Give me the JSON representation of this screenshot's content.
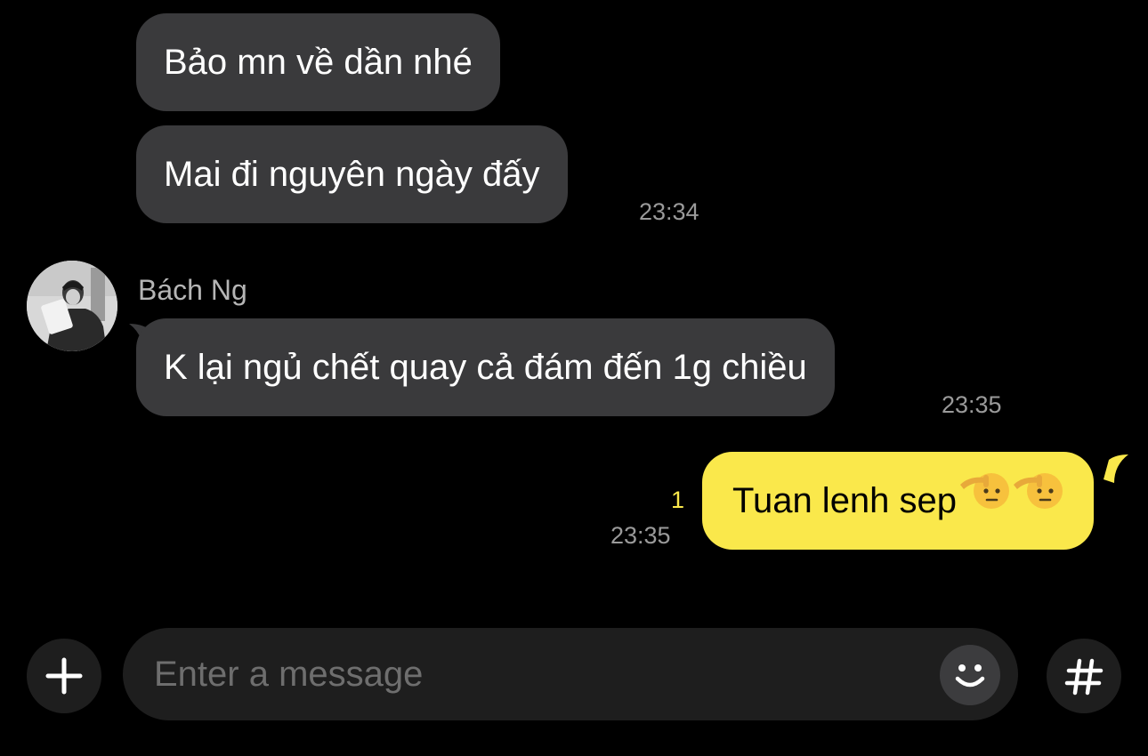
{
  "messages": [
    {
      "text": "Bảo mn về dần nhé"
    },
    {
      "text": "Mai đi nguyên ngày đấy",
      "time": "23:34"
    },
    {
      "sender": "Bách Ng",
      "text": "K lại ngủ chết quay cả đám đến 1g chiều",
      "time": "23:35"
    },
    {
      "text": "Tuan lenh sep",
      "emoji": [
        "saluting-face",
        "saluting-face"
      ],
      "unread_count": "1",
      "time": "23:35"
    }
  ],
  "composer": {
    "placeholder": "Enter a message",
    "add_icon": "plus-icon",
    "emoji_icon": "smiley-icon",
    "hashtag_icon": "hashtag-icon"
  },
  "colors": {
    "background": "#000000",
    "incoming_bubble": "#3a3a3c",
    "outgoing_bubble": "#fae84b",
    "timestamp": "#9a9a9a",
    "unread": "#fae84b"
  }
}
